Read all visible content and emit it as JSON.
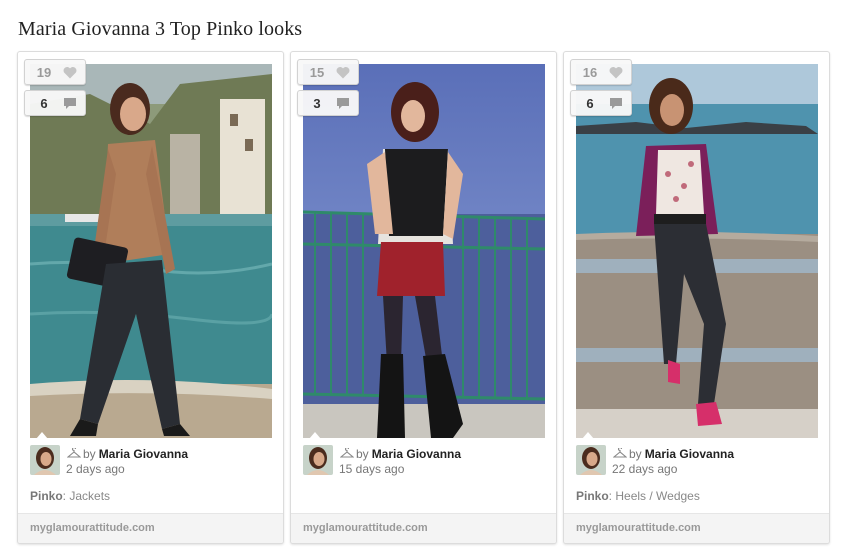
{
  "page": {
    "title": "Maria Giovanna 3 Top Pinko looks"
  },
  "cards": [
    {
      "likes": "19",
      "comments": "6",
      "author_prefix": "by",
      "author": "Maria Giovanna",
      "time": "2 days ago",
      "brand": "Pinko",
      "category_separator": ":",
      "category": "Jackets",
      "source": "myglamourattitude.com"
    },
    {
      "likes": "15",
      "comments": "3",
      "author_prefix": "by",
      "author": "Maria Giovanna",
      "time": "15 days ago",
      "brand": "",
      "category_separator": "",
      "category": "",
      "source": "myglamourattitude.com"
    },
    {
      "likes": "16",
      "comments": "6",
      "author_prefix": "by",
      "author": "Maria Giovanna",
      "time": "22 days ago",
      "brand": "Pinko",
      "category_separator": ":",
      "category": "Heels / Wedges",
      "source": "myglamourattitude.com"
    }
  ],
  "icons": {
    "like": "heart-icon",
    "comment": "speech-bubble-icon",
    "collection": "hanger-icon"
  },
  "colors": {
    "accent_text": "#222222",
    "muted_text": "#777777",
    "footer_bg": "#f4f4f4"
  }
}
